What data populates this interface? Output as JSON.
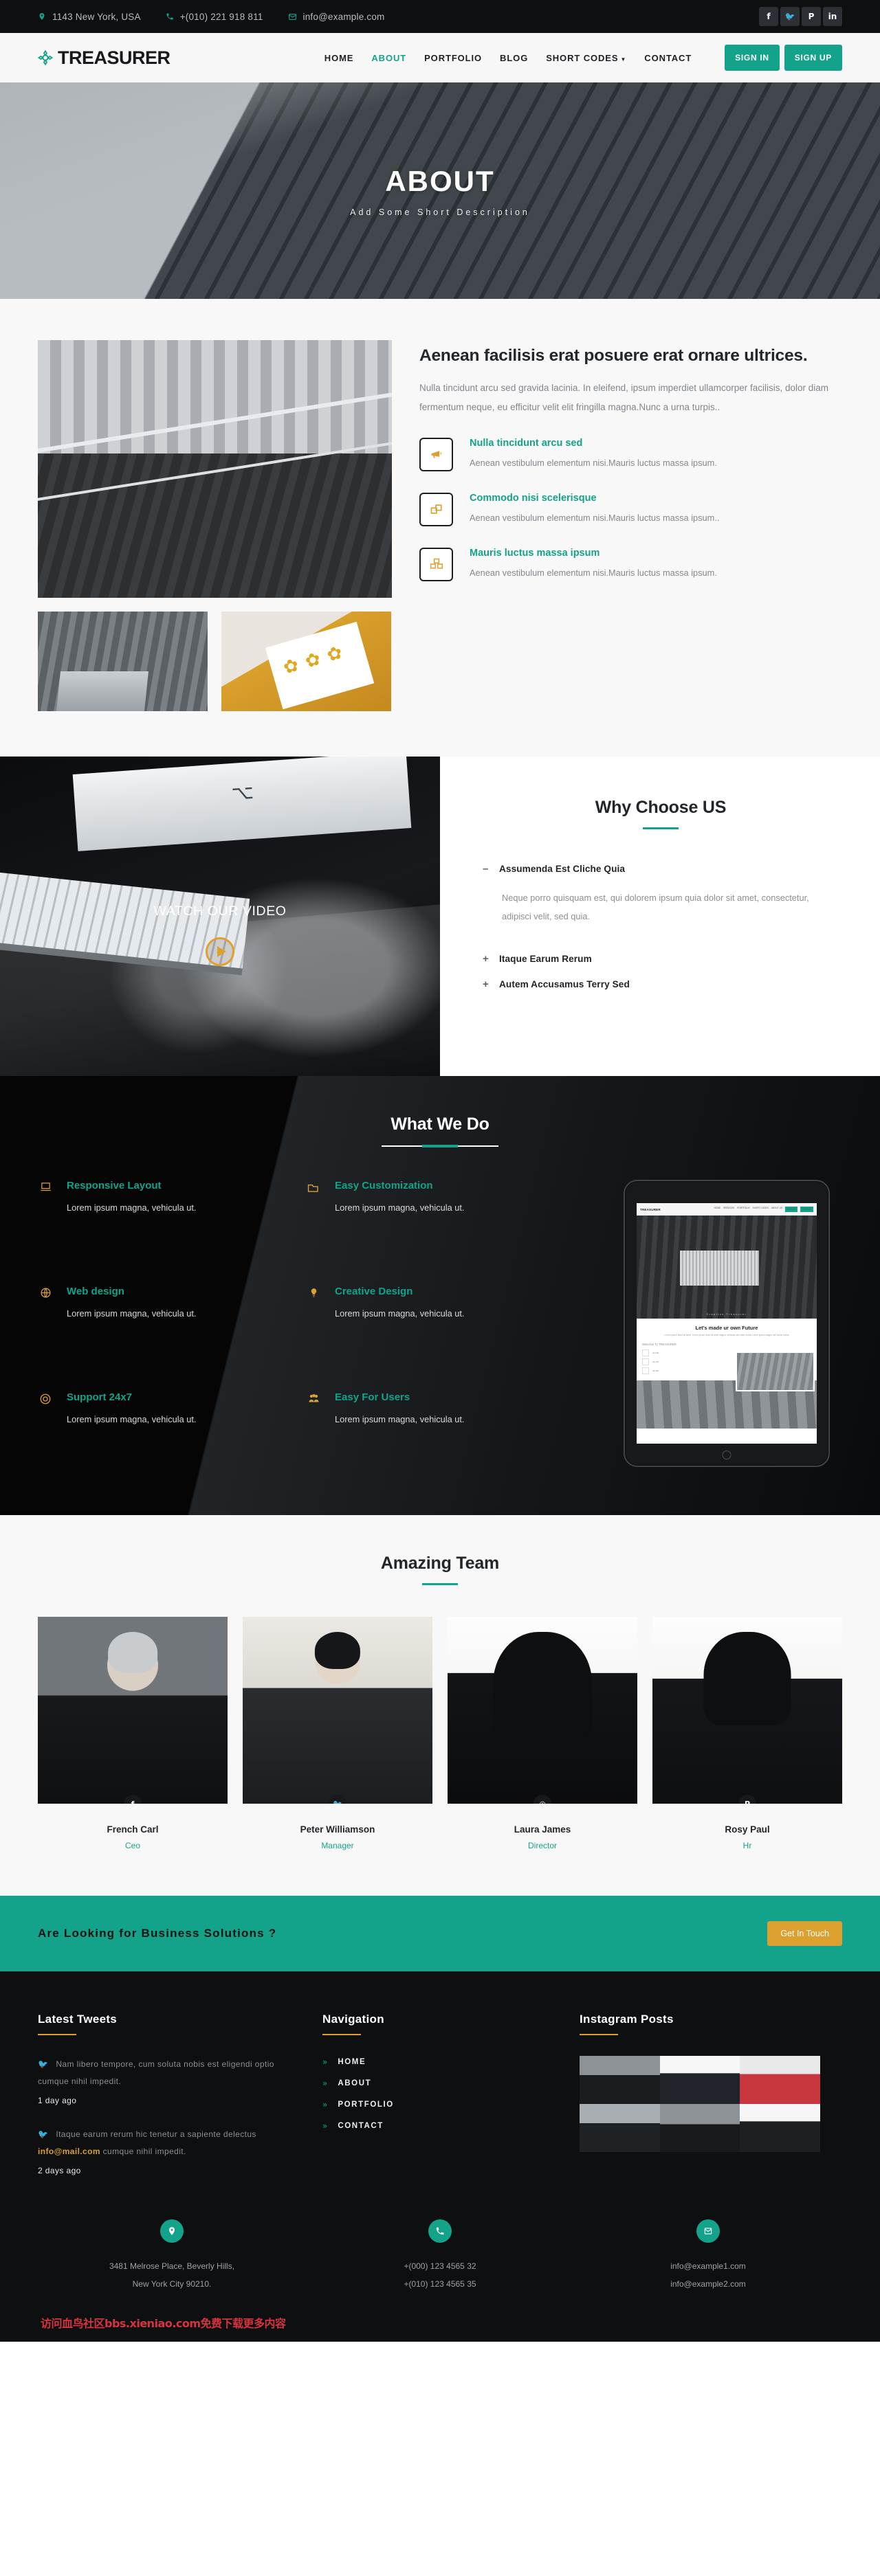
{
  "topbar": {
    "address": "1143 New York, USA",
    "phone": "+(010) 221 918 811",
    "email": "info@example.com",
    "socials": [
      {
        "name": "facebook",
        "glyph": "f"
      },
      {
        "name": "twitter",
        "glyph": "🐦"
      },
      {
        "name": "pinterest",
        "glyph": "P"
      },
      {
        "name": "linkedin",
        "glyph": "in"
      }
    ],
    "accent": "#12a38a"
  },
  "header": {
    "brand": "TREASURER",
    "nav": [
      {
        "label": "HOME",
        "active": false
      },
      {
        "label": "ABOUT",
        "active": true
      },
      {
        "label": "PORTFOLIO",
        "active": false
      },
      {
        "label": "BLOG",
        "active": false
      },
      {
        "label": "SHORT CODES",
        "active": false,
        "caret": true
      },
      {
        "label": "CONTACT",
        "active": false
      }
    ],
    "sign_in": "SIGN IN",
    "sign_up": "SIGN UP"
  },
  "hero": {
    "title": "ABOUT",
    "subtitle": "Add Some Short Description"
  },
  "about": {
    "heading": "Aenean facilisis erat posuere erat ornare ultrices.",
    "lead": "Nulla tincidunt arcu sed gravida lacinia. In eleifend, ipsum imperdiet ullamcorper facilisis, dolor diam fermentum neque, eu efficitur velit elit fringilla magna.Nunc a urna turpis..",
    "features": [
      {
        "icon": "megaphone-icon",
        "glyph": "📣",
        "title": "Nulla tincidunt arcu sed",
        "text": "Aenean vestibulum elementum nisi.Mauris luctus massa ipsum."
      },
      {
        "icon": "layers-icon",
        "glyph": "❏",
        "title": "Commodo nisi scelerisque",
        "text": "Aenean vestibulum elementum nisi.Mauris luctus massa ipsum.."
      },
      {
        "icon": "boxes-icon",
        "glyph": "◨",
        "title": "Mauris luctus massa ipsum",
        "text": "Aenean vestibulum elementum nisi.Mauris luctus massa ipsum."
      }
    ]
  },
  "why": {
    "video_label": "WATCH OUR VIDEO",
    "title": "Why Choose US",
    "items": [
      {
        "sign": "–",
        "title": "Assumenda Est Cliche Quia",
        "open": true,
        "body": "Neque porro quisquam est, qui dolorem ipsum quia dolor sit amet, consectetur, adipisci velit, sed quia."
      },
      {
        "sign": "+",
        "title": "Itaque Earum Rerum",
        "open": false,
        "body": ""
      },
      {
        "sign": "+",
        "title": "Autem Accusamus Terry Sed",
        "open": false,
        "body": ""
      }
    ]
  },
  "what_we_do": {
    "title": "What We Do",
    "items": [
      {
        "icon": "laptop-icon",
        "glyph": "💻",
        "title": "Responsive Layout",
        "text": "Lorem ipsum magna, vehicula ut."
      },
      {
        "icon": "folder-icon",
        "glyph": "🗀",
        "title": "Easy Customization",
        "text": "Lorem ipsum magna, vehicula ut."
      },
      {
        "icon": "globe-icon",
        "glyph": "🌐",
        "title": "Web design",
        "text": "Lorem ipsum magna, vehicula ut."
      },
      {
        "icon": "bulb-icon",
        "glyph": "💡",
        "title": "Creative Design",
        "text": "Lorem ipsum magna, vehicula ut."
      },
      {
        "icon": "lifebuoy-icon",
        "glyph": "🛟",
        "title": "Support 24x7",
        "text": "Lorem ipsum magna, vehicula ut."
      },
      {
        "icon": "users-icon",
        "glyph": "👥",
        "title": "Easy For Users",
        "text": "Lorem ipsum magna, vehicula ut."
      }
    ],
    "tablet": {
      "brand": "TREASURER",
      "nav": [
        "HOME",
        "SERVICES",
        "PORTFOLIO",
        "SHORT CODES",
        "ABOUT US"
      ],
      "btn1": "SIGN IN",
      "btn2": "SIGN UP",
      "hero_caption": "Creative Treasurer",
      "panel_heading": "Let's made ur own Future",
      "panel_sub": "Lorem ipsum dolor sit amet, Lorem ipsum dolor sit amet magna, vehicula utel ullam ioctus Lorem ipsum magna utel luctus ioctus",
      "welcome": "Welcome To TREASURER",
      "rows": [
        {
          "label": "1",
          "value": "23,536"
        },
        {
          "label": "2",
          "value": "18,476"
        },
        {
          "label": "3",
          "value": "49,362"
        }
      ]
    }
  },
  "team": {
    "title": "Amazing Team",
    "members": [
      {
        "name": "French Carl",
        "role": "Ceo",
        "social": "facebook-icon",
        "glyph": "f"
      },
      {
        "name": "Peter Williamson",
        "role": "Manager",
        "social": "twitter-icon",
        "glyph": "🐦"
      },
      {
        "name": "Laura James",
        "role": "Director",
        "social": "instagram-icon",
        "glyph": "◎"
      },
      {
        "name": "Rosy Paul",
        "role": "Hr",
        "social": "pinterest-icon",
        "glyph": "P"
      }
    ]
  },
  "cta": {
    "text": "Are Looking for Business Solutions ?",
    "button": "Get In Touch",
    "bg": "#12a38a",
    "btn_bg": "#dca02f"
  },
  "footer": {
    "tweets_title": "Latest Tweets",
    "tweets": [
      {
        "text_before": "Nam libero tempore, cum soluta nobis est eligendi optio cumque nihil impedit.",
        "link": "",
        "text_after": "",
        "ago": "1 day ago"
      },
      {
        "text_before": "Itaque earum rerum hic tenetur a sapiente delectus ",
        "link": "info@mail.com",
        "text_after": " cumque nihil impedit.",
        "ago": "2 days ago"
      }
    ],
    "nav_title": "Navigation",
    "nav": [
      "HOME",
      "ABOUT",
      "PORTFOLIO",
      "CONTACT"
    ],
    "instagram_title": "Instagram Posts",
    "contact": [
      {
        "icon": "map-pin-icon",
        "glyph": "📍",
        "lines": [
          "3481 Melrose Place, Beverly Hills,",
          "New York City 90210."
        ]
      },
      {
        "icon": "phone-icon",
        "glyph": "📞",
        "lines": [
          "+(000) 123 4565 32",
          "+(010) 123 4565 35"
        ]
      },
      {
        "icon": "envelope-icon",
        "glyph": "✉",
        "lines": [
          "info@example1.com",
          "info@example2.com"
        ]
      }
    ],
    "watermark": "访问血鸟社区bbs.xieniao.com免费下载更多内容"
  }
}
